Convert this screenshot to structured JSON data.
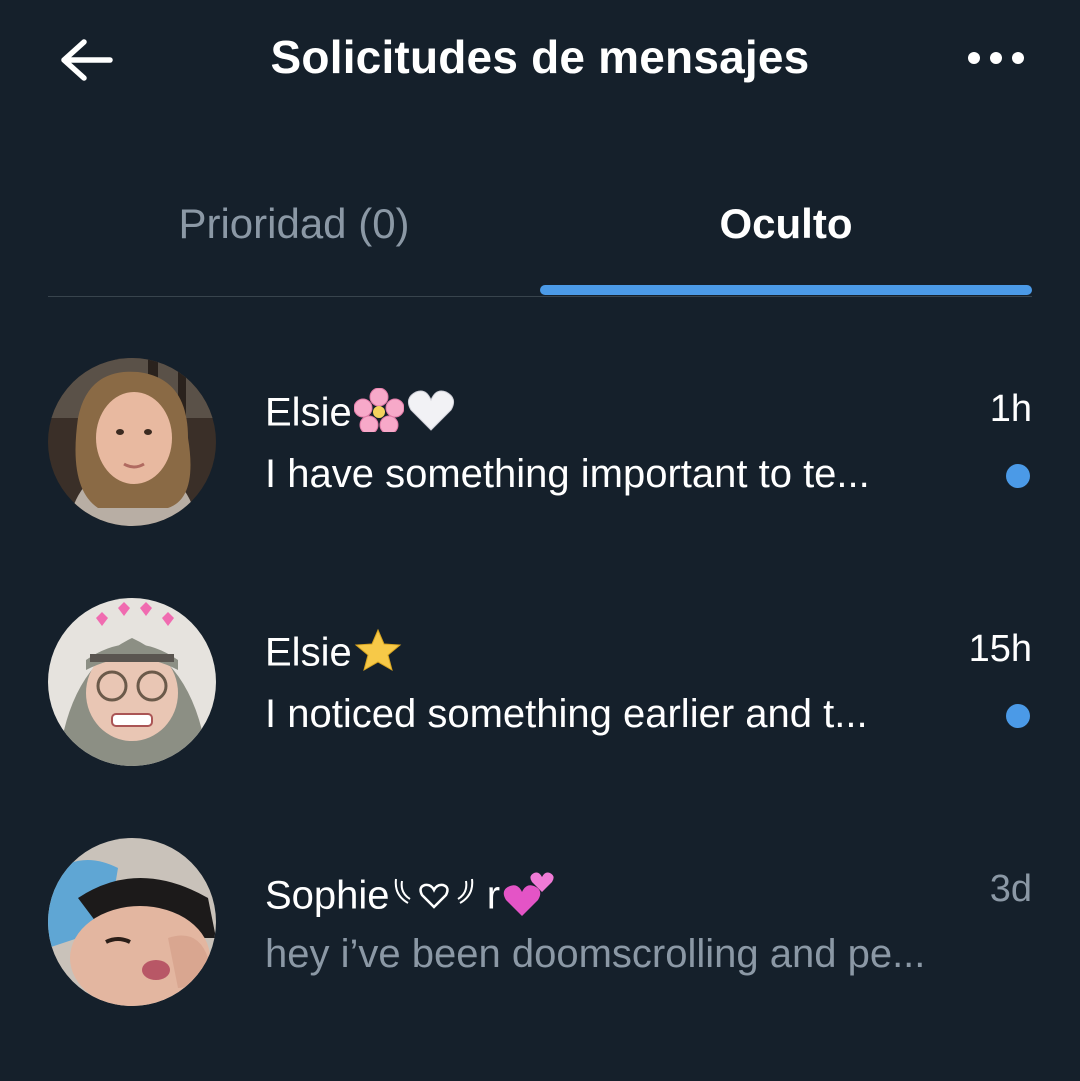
{
  "header": {
    "title": "Solicitudes de mensajes",
    "back_icon": "arrow-left-icon",
    "more_icon": "more-horizontal-icon"
  },
  "tabs": [
    {
      "label": "Prioridad (0)",
      "active": false
    },
    {
      "label": "Oculto",
      "active": true
    }
  ],
  "colors": {
    "background": "#15202b",
    "accent": "#4b9ae7",
    "muted_text": "#8b98a5",
    "divider": "#38444d"
  },
  "conversations": [
    {
      "name": "Elsie",
      "name_emojis": [
        "cherry-blossom-icon",
        "white-heart-icon"
      ],
      "time": "1h",
      "preview": "I have something important to te...",
      "unread": true
    },
    {
      "name": "Elsie",
      "name_emojis": [
        "star-icon"
      ],
      "time": "15h",
      "preview": "I noticed something earlier and t...",
      "unread": true
    },
    {
      "name": "Sophie",
      "name_suffix": "r",
      "name_emojis": [
        "angel-wings-heart-icon",
        "two-hearts-icon"
      ],
      "time": "3d",
      "preview": "hey i’ve been doomscrolling and pe...",
      "unread": false
    }
  ]
}
